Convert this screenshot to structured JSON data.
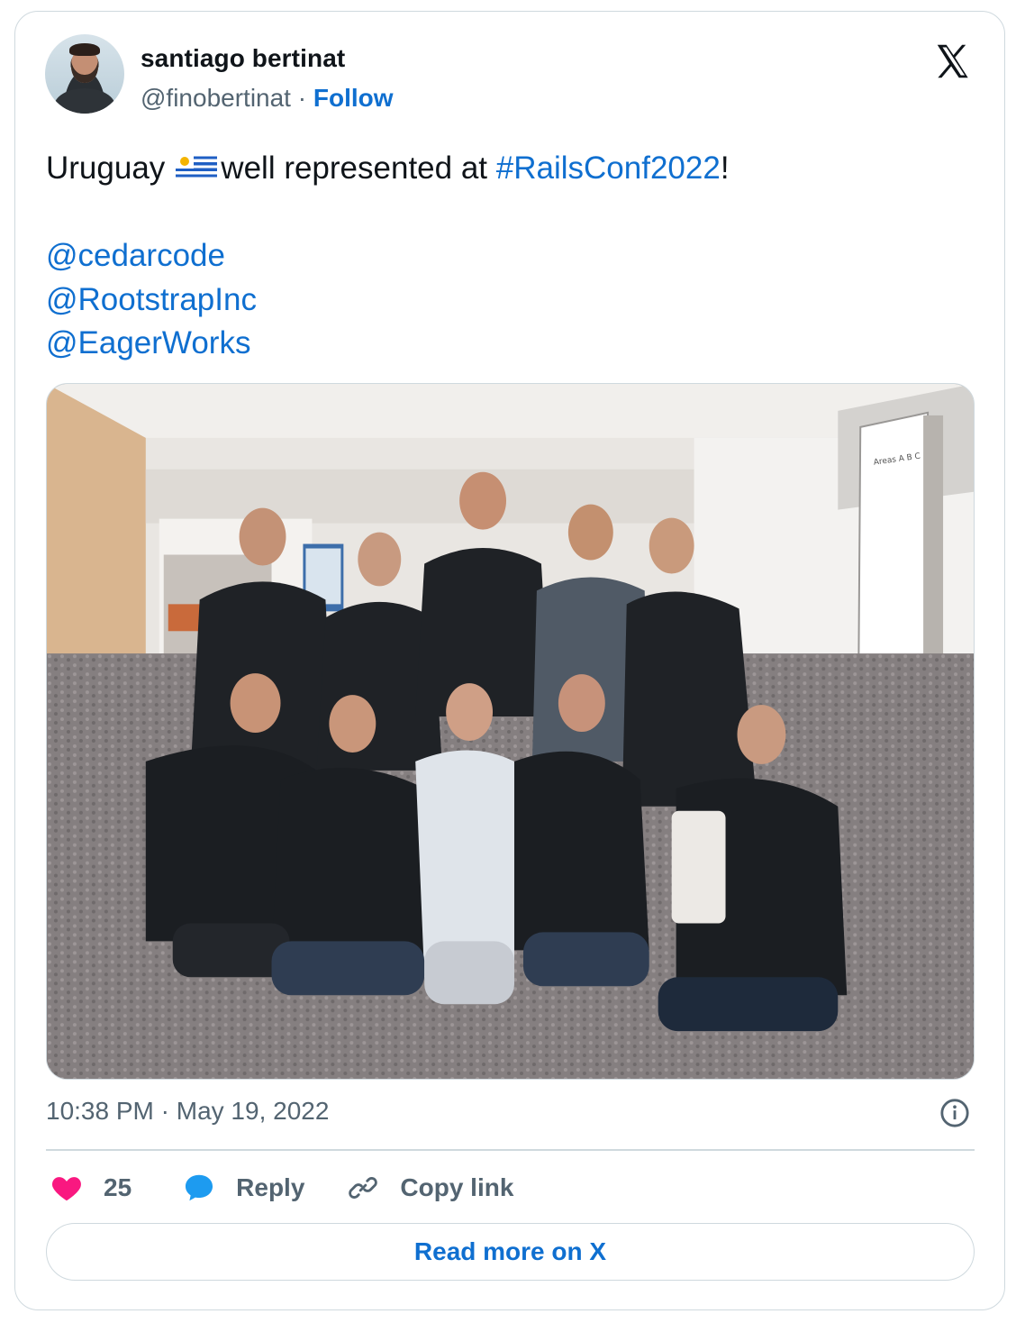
{
  "author": {
    "display_name": "santiago bertinat",
    "handle": "@finobertinat",
    "separator": "·",
    "follow_label": "Follow"
  },
  "tweet": {
    "text_before_flag": "Uruguay",
    "flag_icon": "uruguay-flag-icon",
    "text_after_flag": "well represented at ",
    "hashtag": "#RailsConf2022",
    "text_end": "!",
    "mentions": [
      "@cedarcode",
      "@RootstrapInc",
      "@EagerWorks"
    ]
  },
  "media": {
    "signage_text": "Areas A B C"
  },
  "meta": {
    "time": "10:38 PM",
    "separator": "·",
    "date": "May 19, 2022"
  },
  "actions": {
    "like_count": "25",
    "reply_label": "Reply",
    "copy_link_label": "Copy link"
  },
  "read_more_label": "Read more on X",
  "colors": {
    "link": "#0f6fd0",
    "secondary_text": "#536471",
    "like_heart": "#f91880",
    "reply_bubble": "#1d9bf0",
    "border": "#cfd9de"
  }
}
